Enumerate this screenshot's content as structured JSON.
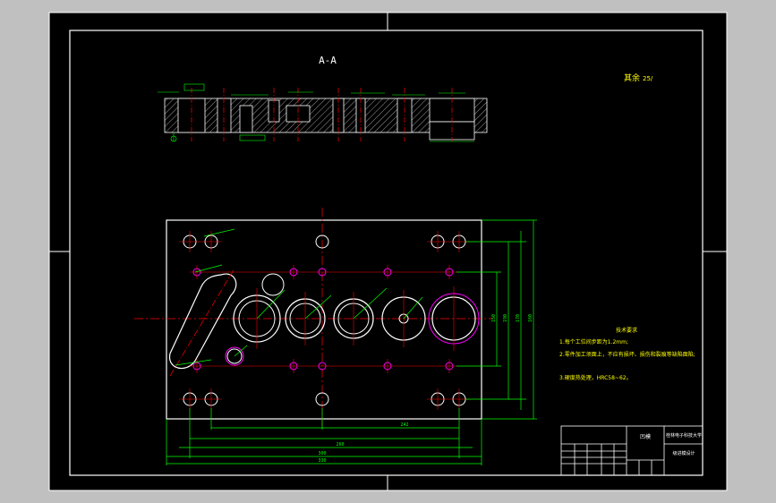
{
  "drawing": {
    "section_title": "A-A",
    "roughness_note": "其余",
    "roughness_value": "25/",
    "tech_requirements": {
      "heading": "技术要求",
      "items": [
        "1.每个工位间步距为1.2mm;",
        "2.零件加工须面上，不应有损坏、损伤和裂痕等缺陷面陷;",
        "3.硬度热处理，HRC58~62。"
      ]
    },
    "title_block": {
      "part_name": "凹模",
      "school": "桂林电子科技大学",
      "drawing_no": "级进模设计"
    },
    "dimensions": {
      "overall_width": "330",
      "width_2": "300",
      "width_3": "260",
      "width_4": "242",
      "height_1": "150",
      "height_2": "190",
      "height_3": "170",
      "height_4": "160"
    }
  },
  "colors": {
    "background": "#000000",
    "frame": "#ffffff",
    "dimension": "#00ff00",
    "centerline": "#ff0000",
    "hidden": "#ff00ff",
    "text": "#ffff00"
  }
}
